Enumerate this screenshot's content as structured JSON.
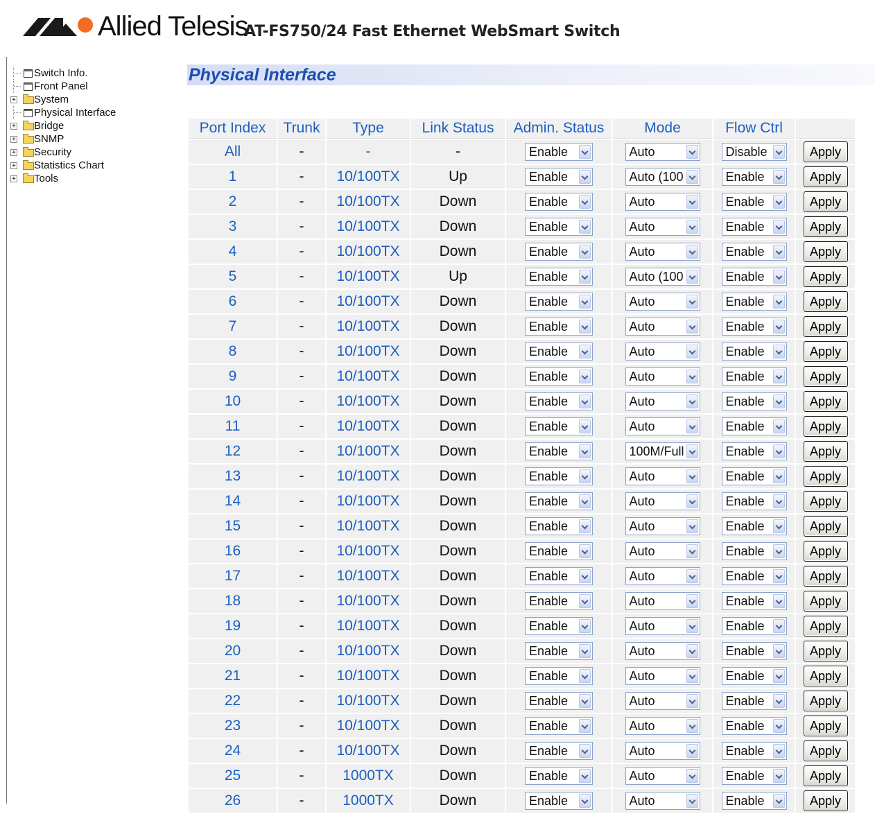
{
  "header": {
    "brand": "Allied Telesis",
    "product": "AT-FS750/24 Fast Ethernet WebSmart Switch"
  },
  "tree": [
    {
      "label": "Switch Info.",
      "icon": "document-icon",
      "expandable": false
    },
    {
      "label": "Front Panel",
      "icon": "document-icon",
      "expandable": false
    },
    {
      "label": "System",
      "icon": "folder-icon",
      "expandable": true
    },
    {
      "label": "Physical Interface",
      "icon": "document-icon",
      "expandable": false
    },
    {
      "label": "Bridge",
      "icon": "folder-icon",
      "expandable": true
    },
    {
      "label": "SNMP",
      "icon": "folder-icon",
      "expandable": true
    },
    {
      "label": "Security",
      "icon": "folder-icon",
      "expandable": true
    },
    {
      "label": "Statistics Chart",
      "icon": "folder-icon",
      "expandable": true
    },
    {
      "label": "Tools",
      "icon": "folder-icon",
      "expandable": true
    }
  ],
  "page": {
    "title": "Physical Interface"
  },
  "table": {
    "headers": [
      "Port Index",
      "Trunk",
      "Type",
      "Link Status",
      "Admin. Status",
      "Mode",
      "Flow Ctrl",
      ""
    ],
    "apply_label": "Apply",
    "rows": [
      {
        "port": "All",
        "trunk": "-",
        "type": "-",
        "link": "-",
        "admin": "Enable",
        "mode": "Auto",
        "flow": "Disable"
      },
      {
        "port": "1",
        "trunk": "-",
        "type": "10/100TX",
        "link": "Up",
        "admin": "Enable",
        "mode": "Auto (100",
        "flow": "Enable"
      },
      {
        "port": "2",
        "trunk": "-",
        "type": "10/100TX",
        "link": "Down",
        "admin": "Enable",
        "mode": "Auto",
        "flow": "Enable"
      },
      {
        "port": "3",
        "trunk": "-",
        "type": "10/100TX",
        "link": "Down",
        "admin": "Enable",
        "mode": "Auto",
        "flow": "Enable"
      },
      {
        "port": "4",
        "trunk": "-",
        "type": "10/100TX",
        "link": "Down",
        "admin": "Enable",
        "mode": "Auto",
        "flow": "Enable"
      },
      {
        "port": "5",
        "trunk": "-",
        "type": "10/100TX",
        "link": "Up",
        "admin": "Enable",
        "mode": "Auto (100",
        "flow": "Enable"
      },
      {
        "port": "6",
        "trunk": "-",
        "type": "10/100TX",
        "link": "Down",
        "admin": "Enable",
        "mode": "Auto",
        "flow": "Enable"
      },
      {
        "port": "7",
        "trunk": "-",
        "type": "10/100TX",
        "link": "Down",
        "admin": "Enable",
        "mode": "Auto",
        "flow": "Enable"
      },
      {
        "port": "8",
        "trunk": "-",
        "type": "10/100TX",
        "link": "Down",
        "admin": "Enable",
        "mode": "Auto",
        "flow": "Enable"
      },
      {
        "port": "9",
        "trunk": "-",
        "type": "10/100TX",
        "link": "Down",
        "admin": "Enable",
        "mode": "Auto",
        "flow": "Enable"
      },
      {
        "port": "10",
        "trunk": "-",
        "type": "10/100TX",
        "link": "Down",
        "admin": "Enable",
        "mode": "Auto",
        "flow": "Enable"
      },
      {
        "port": "11",
        "trunk": "-",
        "type": "10/100TX",
        "link": "Down",
        "admin": "Enable",
        "mode": "Auto",
        "flow": "Enable"
      },
      {
        "port": "12",
        "trunk": "-",
        "type": "10/100TX",
        "link": "Down",
        "admin": "Enable",
        "mode": "100M/Full",
        "flow": "Enable"
      },
      {
        "port": "13",
        "trunk": "-",
        "type": "10/100TX",
        "link": "Down",
        "admin": "Enable",
        "mode": "Auto",
        "flow": "Enable"
      },
      {
        "port": "14",
        "trunk": "-",
        "type": "10/100TX",
        "link": "Down",
        "admin": "Enable",
        "mode": "Auto",
        "flow": "Enable"
      },
      {
        "port": "15",
        "trunk": "-",
        "type": "10/100TX",
        "link": "Down",
        "admin": "Enable",
        "mode": "Auto",
        "flow": "Enable"
      },
      {
        "port": "16",
        "trunk": "-",
        "type": "10/100TX",
        "link": "Down",
        "admin": "Enable",
        "mode": "Auto",
        "flow": "Enable"
      },
      {
        "port": "17",
        "trunk": "-",
        "type": "10/100TX",
        "link": "Down",
        "admin": "Enable",
        "mode": "Auto",
        "flow": "Enable"
      },
      {
        "port": "18",
        "trunk": "-",
        "type": "10/100TX",
        "link": "Down",
        "admin": "Enable",
        "mode": "Auto",
        "flow": "Enable"
      },
      {
        "port": "19",
        "trunk": "-",
        "type": "10/100TX",
        "link": "Down",
        "admin": "Enable",
        "mode": "Auto",
        "flow": "Enable"
      },
      {
        "port": "20",
        "trunk": "-",
        "type": "10/100TX",
        "link": "Down",
        "admin": "Enable",
        "mode": "Auto",
        "flow": "Enable"
      },
      {
        "port": "21",
        "trunk": "-",
        "type": "10/100TX",
        "link": "Down",
        "admin": "Enable",
        "mode": "Auto",
        "flow": "Enable"
      },
      {
        "port": "22",
        "trunk": "-",
        "type": "10/100TX",
        "link": "Down",
        "admin": "Enable",
        "mode": "Auto",
        "flow": "Enable"
      },
      {
        "port": "23",
        "trunk": "-",
        "type": "10/100TX",
        "link": "Down",
        "admin": "Enable",
        "mode": "Auto",
        "flow": "Enable"
      },
      {
        "port": "24",
        "trunk": "-",
        "type": "10/100TX",
        "link": "Down",
        "admin": "Enable",
        "mode": "Auto",
        "flow": "Enable"
      },
      {
        "port": "25",
        "trunk": "-",
        "type": "1000TX",
        "link": "Down",
        "admin": "Enable",
        "mode": "Auto",
        "flow": "Enable"
      },
      {
        "port": "26",
        "trunk": "-",
        "type": "1000TX",
        "link": "Down",
        "admin": "Enable",
        "mode": "Auto",
        "flow": "Enable"
      }
    ]
  },
  "colors": {
    "link_blue": "#1a5fc0",
    "title_blue": "#1a4fb0",
    "cell_gray": "#f0f0f0",
    "logo_dark": "#1a1a1a",
    "logo_orange": "#f26c23"
  }
}
